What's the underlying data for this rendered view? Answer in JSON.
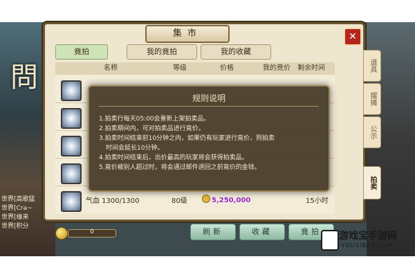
{
  "window": {
    "title": "集市",
    "close_label": "✕"
  },
  "tabs": [
    {
      "label": "竟拍",
      "active": true
    },
    {
      "label": "我的竟拍",
      "active": false
    },
    {
      "label": "我的收藏",
      "active": false
    }
  ],
  "columns": {
    "name": "名称",
    "level": "等级",
    "price": "价格",
    "my_bid": "我的竟价",
    "time_left": "剩余时间"
  },
  "list": {
    "row5": {
      "name": "气血 1300/1300",
      "level": "80级",
      "price": "5,250,000",
      "time_left": "15小时"
    }
  },
  "side_tabs": [
    "道具",
    "摆摊",
    "公示",
    "拍卖"
  ],
  "buttons": {
    "refresh": "刷新",
    "favorite": "收藏",
    "bid": "竟拍"
  },
  "currency": {
    "value": "0"
  },
  "modal": {
    "title": "规则说明",
    "rules": [
      "1.拍卖行每天05:00会重新上架拍卖品。",
      "2.拍卖期间内，可对拍卖品进行竟价。",
      "3.拍卖时间结束前10分钟之内，如果仍有玩家进行竟价，则拍卖",
      "时间会延长10分钟。",
      "4.拍卖时间结束后，出价最高的玩家将会获得拍卖品。",
      "5.竟价被别人超过时，将会通过邮件退回之前竟价的金钱。"
    ]
  },
  "side_chat": [
    "世界[高歌猛",
    "世界[Cra~",
    "世界[缘来",
    "世界[积分"
  ],
  "watermark": {
    "text": "游戏宝手游网",
    "url": "YOUXIBAO.COM"
  },
  "colors": {
    "price": "#9b2ad3",
    "close": "#b3261e",
    "tab_active": "#cfe3b8"
  }
}
